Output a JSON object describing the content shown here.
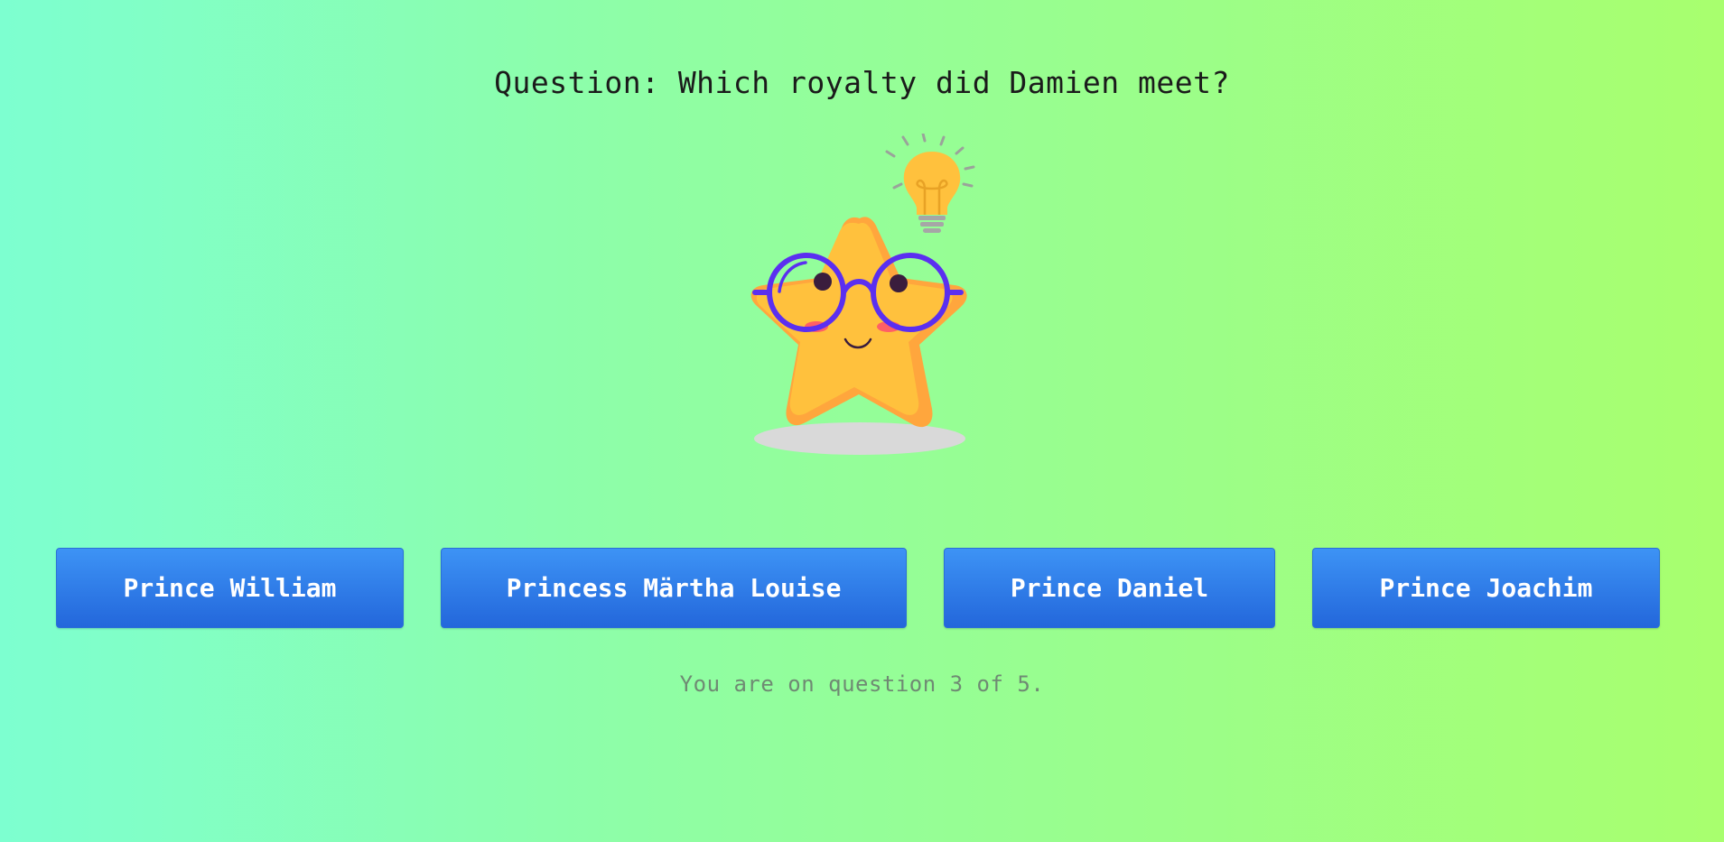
{
  "question": {
    "text": "Question: Which royalty did Damien meet?"
  },
  "answers": [
    {
      "label": "Prince William"
    },
    {
      "label": "Princess Märtha Louise"
    },
    {
      "label": "Prince Daniel"
    },
    {
      "label": "Prince Joachim"
    }
  ],
  "progress": {
    "text": "You are on question 3 of 5.",
    "current": 3,
    "total": 5
  },
  "mascot": {
    "icon": "thinking-star-mascot-icon",
    "idea_icon": "lightbulb-icon"
  },
  "colors": {
    "background_start": "#7dffd0",
    "background_end": "#a8ff6e",
    "button": "#2f7de8",
    "star": "#ffc13d",
    "glasses": "#5b2ff0"
  }
}
